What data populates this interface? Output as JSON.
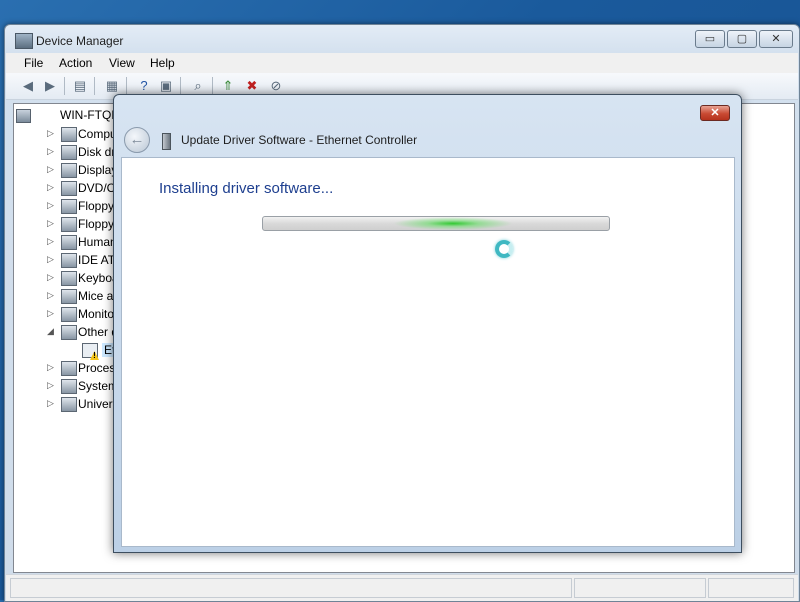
{
  "device_manager": {
    "title": "Device Manager",
    "caption_buttons": {
      "minimize": "▭",
      "maximize": "▢",
      "close": "✕"
    },
    "menu": [
      "File",
      "Action",
      "View",
      "Help"
    ],
    "toolbar_icons": [
      "back-arrow-icon",
      "forward-arrow-icon",
      "properties-icon",
      "details-icon",
      "help-icon",
      "action-icon",
      "scan-hardware-icon",
      "update-driver-icon",
      "uninstall-icon",
      "disable-icon"
    ],
    "tree": {
      "root": "WIN-FTQR",
      "items": [
        {
          "label": "Compu",
          "expander": "▷"
        },
        {
          "label": "Disk dr",
          "expander": "▷"
        },
        {
          "label": "Display",
          "expander": "▷"
        },
        {
          "label": "DVD/C",
          "expander": "▷"
        },
        {
          "label": "Floppy",
          "expander": "▷"
        },
        {
          "label": "Floppy",
          "expander": "▷"
        },
        {
          "label": "Human",
          "expander": "▷"
        },
        {
          "label": "IDE AT",
          "expander": "▷"
        },
        {
          "label": "Keyboa",
          "expander": "▷"
        },
        {
          "label": "Mice a",
          "expander": "▷"
        },
        {
          "label": "Monito",
          "expander": "▷"
        },
        {
          "label": "Other d",
          "expander": "◢"
        },
        {
          "label": "Proces",
          "expander": "▷"
        },
        {
          "label": "System",
          "expander": "▷"
        },
        {
          "label": "Univers",
          "expander": "▷"
        }
      ],
      "selected_child": "Eth"
    }
  },
  "dialog": {
    "title": "Update Driver Software - Ethernet Controller",
    "back_glyph": "←",
    "close_glyph": "✕",
    "heading": "Installing driver software...",
    "progress_state": "indeterminate",
    "accent_color": "#1e3f8f",
    "progress_color": "#28c828"
  }
}
